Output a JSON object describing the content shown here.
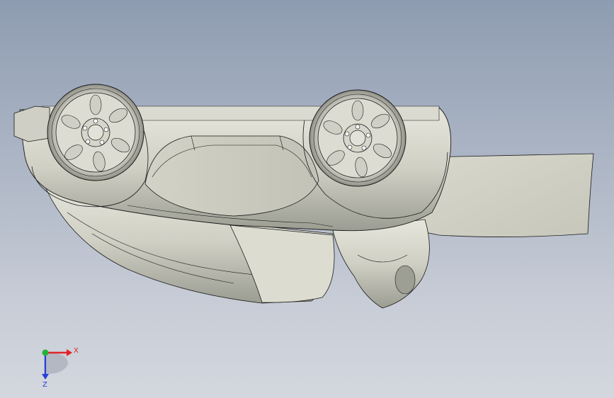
{
  "view": {
    "background_top": "#8e9cb1",
    "background_bottom": "#d4d7de",
    "model_fill": "#dcdcd2",
    "model_shadow": "#a9aa9f",
    "edge_color": "#1a1a1a"
  },
  "triad": {
    "x_label": "X",
    "z_label": "Z",
    "x_color": "#e0242a",
    "y_color": "#23b23a",
    "z_color": "#2a3fd8"
  },
  "model": {
    "name_icon": "car-underbody-model",
    "wheels": [
      "left-wheel",
      "right-wheel"
    ]
  }
}
